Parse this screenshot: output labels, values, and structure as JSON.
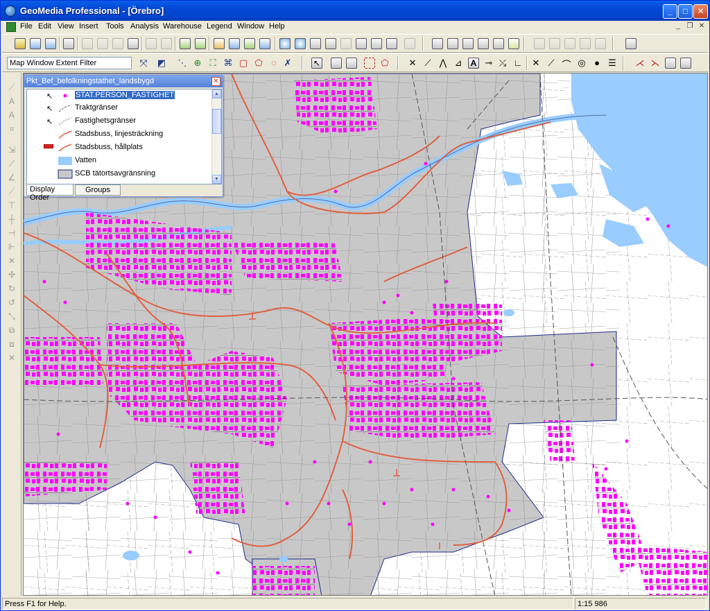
{
  "window": {
    "title": "GeoMedia Professional - [Örebro]"
  },
  "menu": {
    "items": [
      "File",
      "Edit",
      "View",
      "Insert",
      "Tools",
      "Analysis",
      "Warehouse",
      "Legend",
      "Window",
      "Help"
    ]
  },
  "toolbar2": {
    "map_window_filter": "Map Window Extent Filter"
  },
  "legend": {
    "title": "Pkt_Bef_befolkningstathet_landsbygd",
    "entries": [
      {
        "label": "STAT.PERSON_FASTIGHET",
        "symbol": "point-magenta",
        "selected": true
      },
      {
        "label": "Traktgränser",
        "symbol": "dashed-line-gray"
      },
      {
        "label": "Fastighetsgränser",
        "symbol": "dashed-line-gray"
      },
      {
        "label": "Stadsbuss, linjesträckning",
        "symbol": "line-red"
      },
      {
        "label": "Stadsbuss, hållplats",
        "symbol": "stop-red"
      },
      {
        "label": "Vatten",
        "symbol": "area-blue"
      },
      {
        "label": "SCB tätortsavgränsning",
        "symbol": "area-gray"
      }
    ],
    "tabs": [
      "Display Order",
      "Groups"
    ],
    "active_tab": "Display Order"
  },
  "status": {
    "help": "Press F1 for Help.",
    "scale": "1:15 986"
  },
  "colors": {
    "urban_area": "#C8C8C8",
    "water": "#99CCFF",
    "bus_line": "#E06040",
    "points": "#FF00FF",
    "title_bar": "#0348D6"
  }
}
